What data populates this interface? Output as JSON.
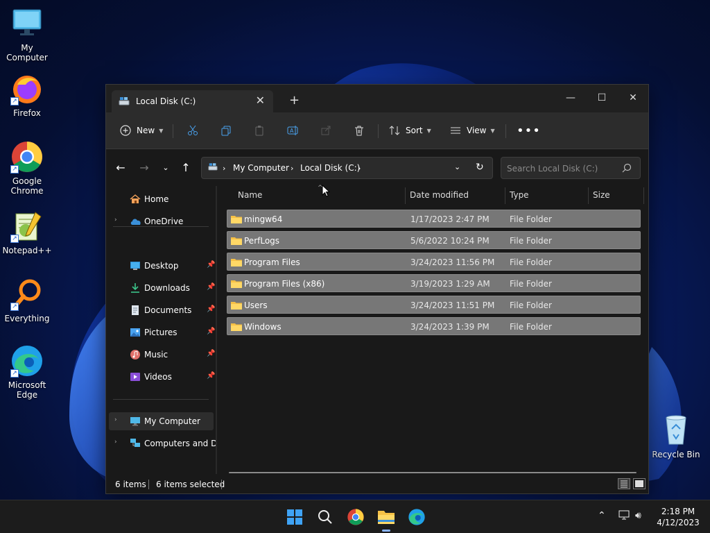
{
  "desktop": {
    "icons": [
      {
        "name": "my-computer",
        "label": "My Computer"
      },
      {
        "name": "firefox",
        "label": "Firefox"
      },
      {
        "name": "chrome",
        "label": "Google Chrome"
      },
      {
        "name": "notepadpp",
        "label": "Notepad++"
      },
      {
        "name": "everything",
        "label": "Everything"
      },
      {
        "name": "edge",
        "label": "Microsoft Edge"
      },
      {
        "name": "recycle-bin",
        "label": "Recycle Bin"
      }
    ]
  },
  "window": {
    "tab_title": "Local Disk (C:)",
    "toolbar": {
      "new_label": "New",
      "sort_label": "Sort",
      "view_label": "View"
    },
    "address": {
      "segments": [
        "My Computer",
        "Local Disk (C:)"
      ]
    },
    "search": {
      "placeholder": "Search Local Disk (C:)"
    },
    "sidebar": {
      "home": "Home",
      "onedrive": "OneDrive",
      "quick": [
        "Desktop",
        "Downloads",
        "Documents",
        "Pictures",
        "Music",
        "Videos"
      ],
      "my_computer": "My Computer",
      "network": "Computers and Devices"
    },
    "columns": {
      "name": "Name",
      "date": "Date modified",
      "type": "Type",
      "size": "Size"
    },
    "files": [
      {
        "name": "mingw64",
        "date": "1/17/2023 2:47 PM",
        "type": "File Folder"
      },
      {
        "name": "PerfLogs",
        "date": "5/6/2022 10:24 PM",
        "type": "File Folder"
      },
      {
        "name": "Program Files",
        "date": "3/24/2023 11:56 PM",
        "type": "File Folder"
      },
      {
        "name": "Program Files (x86)",
        "date": "3/19/2023 1:29 AM",
        "type": "File Folder"
      },
      {
        "name": "Users",
        "date": "3/24/2023 11:51 PM",
        "type": "File Folder"
      },
      {
        "name": "Windows",
        "date": "3/24/2023 1:39 PM",
        "type": "File Folder"
      }
    ],
    "status": {
      "items": "6 items",
      "selected": "6 items selected"
    }
  },
  "taskbar": {
    "time": "2:18 PM",
    "date": "4/12/2023"
  }
}
